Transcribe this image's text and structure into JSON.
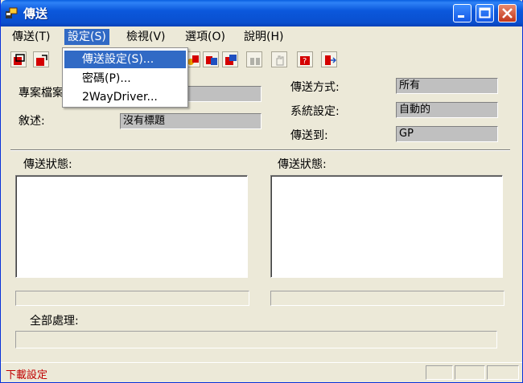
{
  "window": {
    "title": "傳送"
  },
  "menubar": {
    "items": [
      {
        "label": "傳送(T)"
      },
      {
        "label": "設定(S)"
      },
      {
        "label": "檢視(V)"
      },
      {
        "label": "選項(O)"
      },
      {
        "label": "說明(H)"
      }
    ]
  },
  "dropdown": {
    "items": [
      {
        "label": "傳送設定(S)..."
      },
      {
        "label": "密碼(P)..."
      },
      {
        "label": "2WayDriver..."
      }
    ]
  },
  "form": {
    "project_file_label": "專案檔案",
    "project_file_value": "",
    "description_label": "敘述:",
    "description_value": "沒有標題",
    "transfer_mode_label": "傳送方式:",
    "transfer_mode_value": "所有",
    "system_setting_label": "系統設定:",
    "system_setting_value": "自動的",
    "transfer_to_label": "傳送到:",
    "transfer_to_value": "GP"
  },
  "status_panels": {
    "left_label": "傳送狀態:",
    "right_label": "傳送狀態:",
    "overall_label": "全部處理:"
  },
  "statusbar": {
    "text": "下載設定"
  },
  "colors": {
    "title_bar": "#0A4FCF",
    "highlight": "#316AC5",
    "status_text": "#C00000",
    "face": "#ECE9D8"
  }
}
